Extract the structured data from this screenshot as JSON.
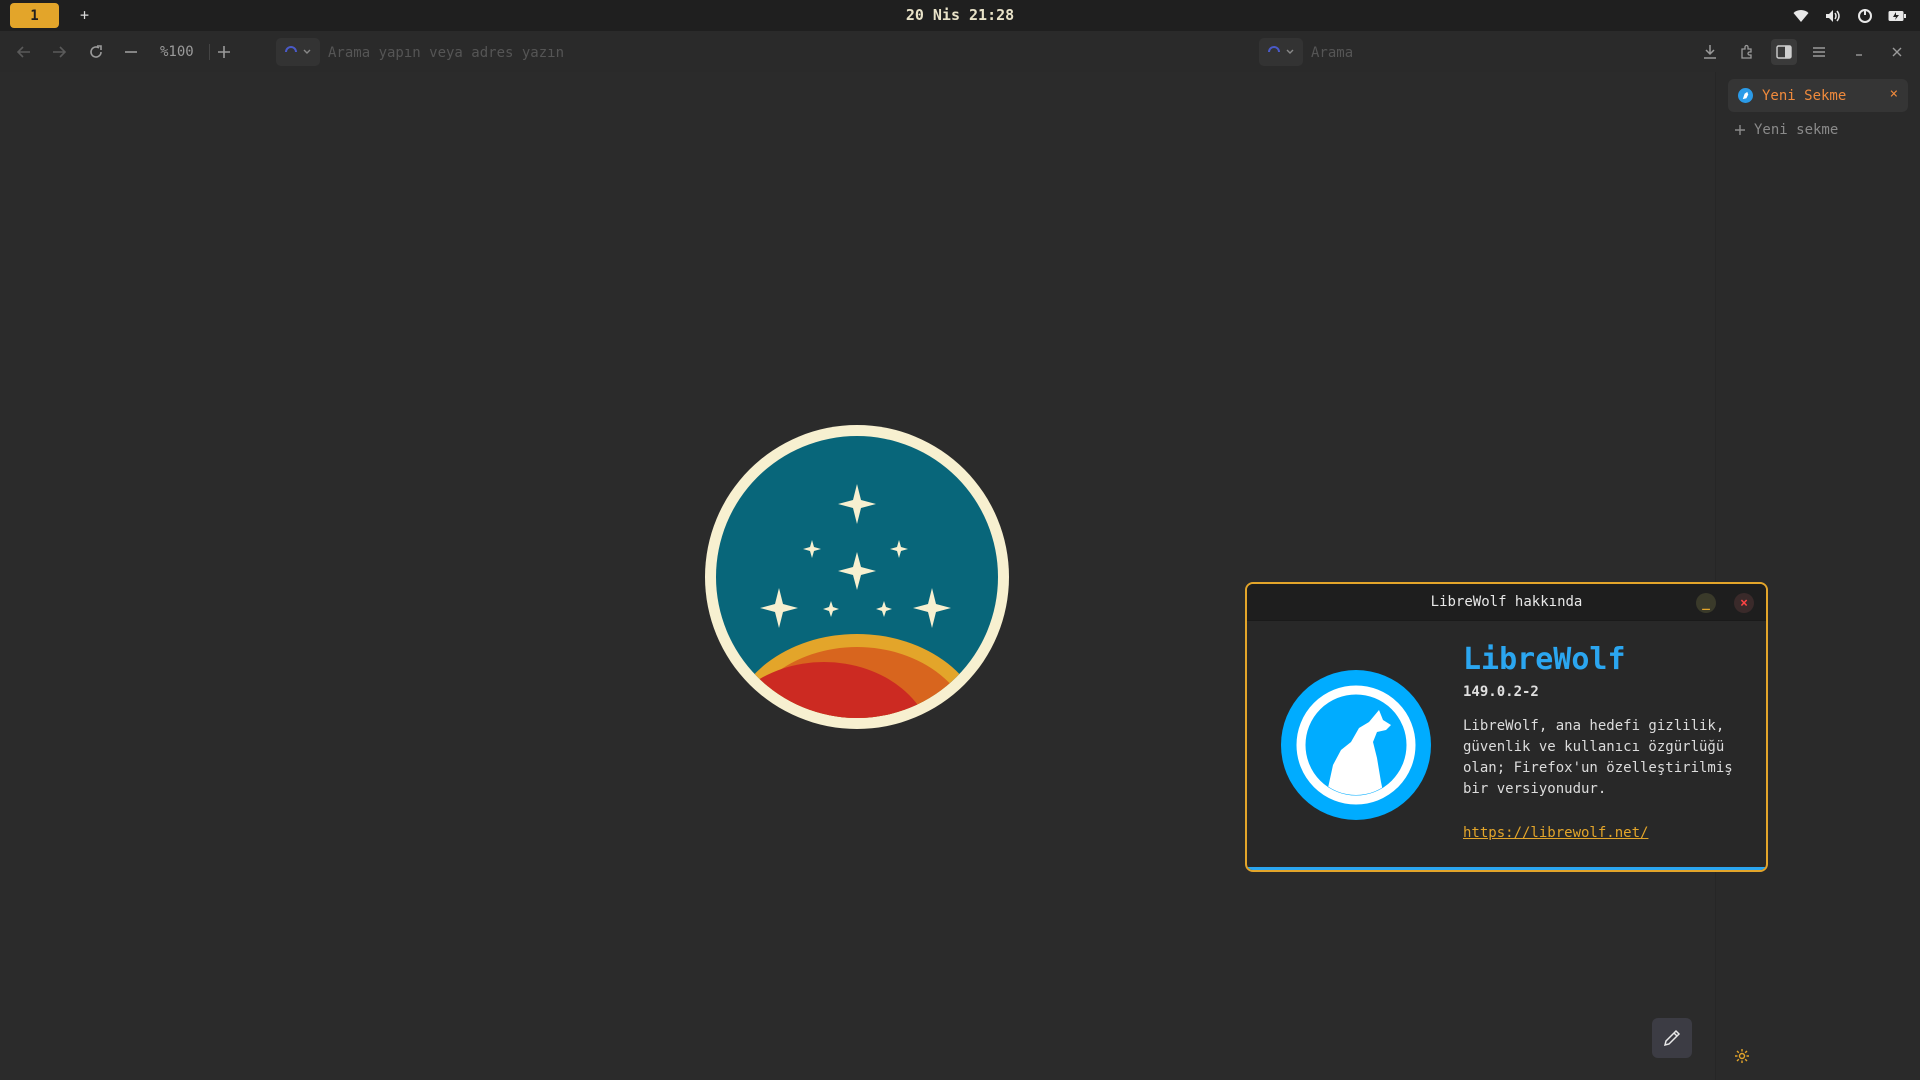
{
  "topbar": {
    "workspace_active": "1",
    "workspace_add": "+",
    "clock": "20 Nis 21:28"
  },
  "navbar": {
    "zoom": "%100",
    "url_placeholder": "Arama yapın veya adres yazın",
    "search_placeholder": "Arama"
  },
  "sidebar": {
    "active_tab": "Yeni Sekme",
    "close_symbol": "×",
    "new_tab": "Yeni sekme"
  },
  "dialog": {
    "title": "LibreWolf hakkında",
    "app_name": "LibreWolf",
    "version": "149.0.2-2",
    "description": "LibreWolf, ana hedefi gizlilik, güvenlik ve kullanıcı özgürlüğü olan; Firefox'un özelleştirilmiş bir versiyonudur.",
    "link": "https://librewolf.net/",
    "minimize_symbol": "_",
    "close_symbol": "×"
  },
  "colors": {
    "accent": "#e3a52a",
    "brand": "#2ba6f0",
    "tab_text": "#f08a3c",
    "logo_bg": "#08667a",
    "logo_ring": "#f7f0d0"
  },
  "icons": [
    "back-icon",
    "forward-icon",
    "reload-icon",
    "zoom-out-icon",
    "zoom-in-icon",
    "download-icon",
    "extensions-icon",
    "sidebar-toggle-icon",
    "menu-icon",
    "minimize-icon",
    "close-icon",
    "wifi-icon",
    "volume-icon",
    "power-icon",
    "battery-icon",
    "gear-icon",
    "pencil-icon"
  ]
}
